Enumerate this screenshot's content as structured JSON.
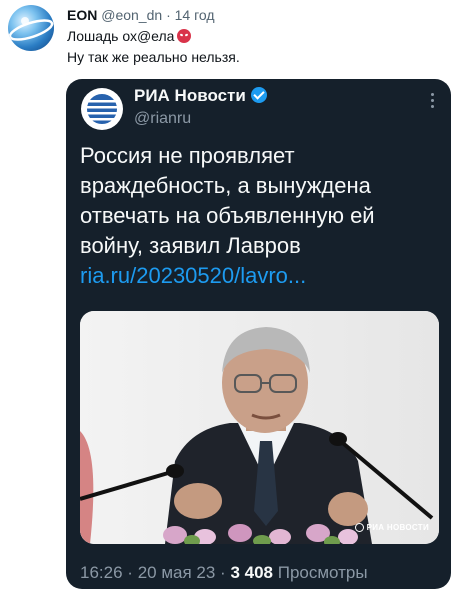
{
  "tweet": {
    "display_name": "EON",
    "handle": "@eon_dn",
    "separator": "·",
    "time": "14 год",
    "line1": "Лошадь ох@ела",
    "line2": "Ну так же реально нельзя.",
    "emoji_icon": "angry-face-icon"
  },
  "quoted": {
    "display_name": "РИА Новости",
    "handle": "@rianru",
    "text_lines": [
      "Россия не проявляет",
      "враждебность, а вынуждена",
      "отвечать на объявленную ей",
      "войну, заявил Лавров"
    ],
    "link": "ria.ru/20230520/lavro...",
    "watermark": "РИА НОВОСТИ",
    "time": "16:26",
    "separator": "·",
    "date": "20 мая 23",
    "views_count": "3 408",
    "views_label": "Просмотры"
  },
  "colors": {
    "card_bg": "#15202b",
    "link": "#1d9bf0",
    "muted": "#8b98a5",
    "verified": "#1d9bf0",
    "emoji": "#d9334a"
  }
}
